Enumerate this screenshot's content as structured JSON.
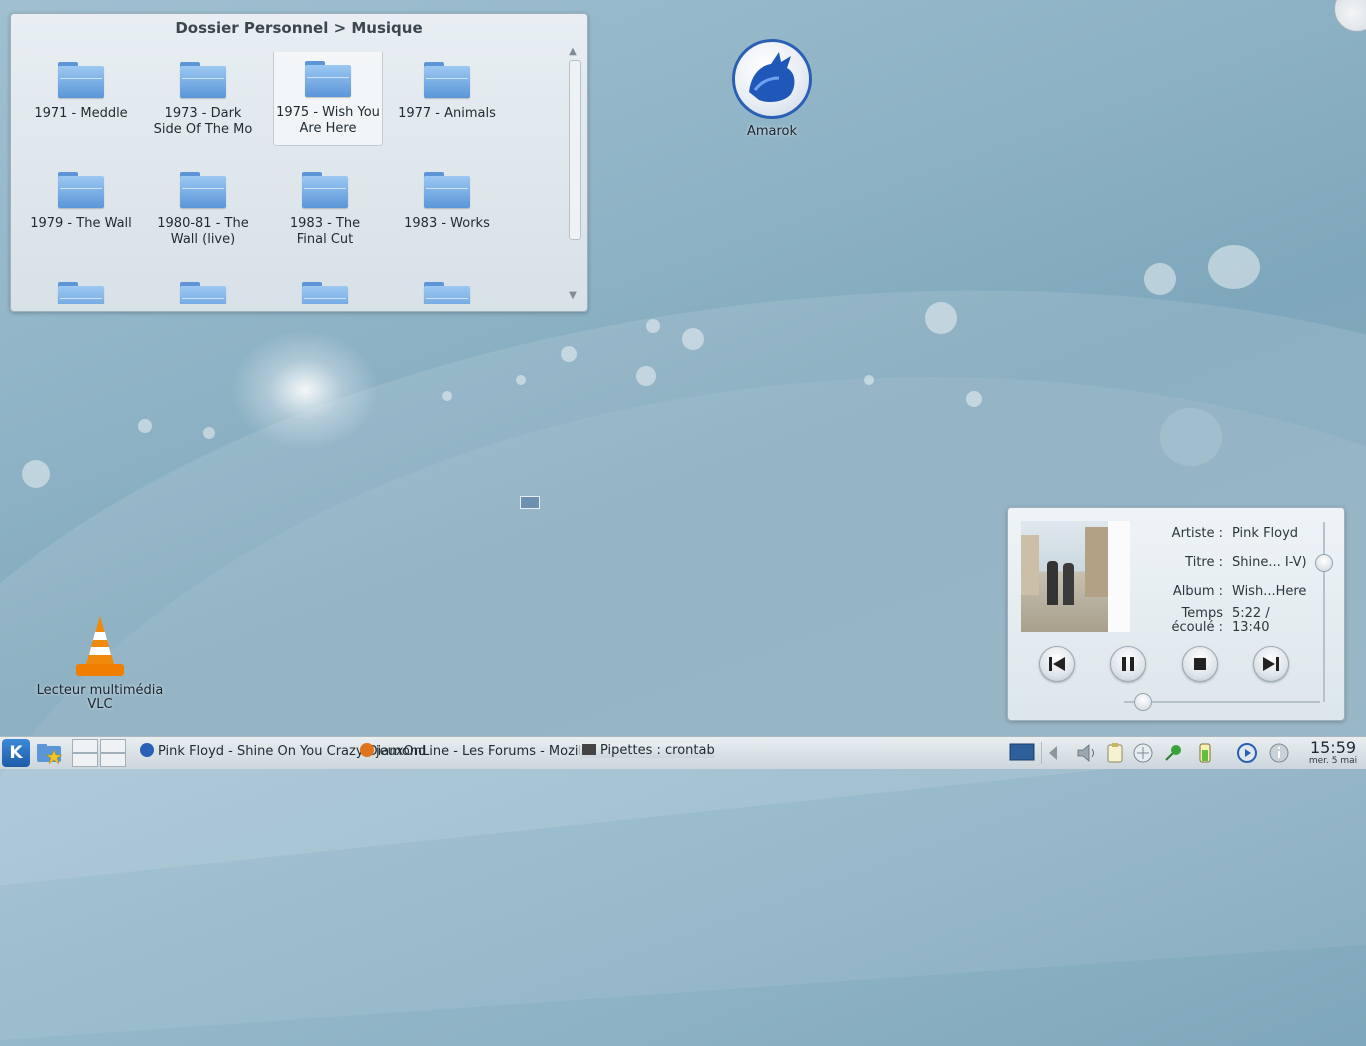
{
  "folderview": {
    "title": "Dossier Personnel > Musique",
    "items": [
      {
        "label": "1971 - Meddle"
      },
      {
        "label": "1973 - Dark Side Of The Mo"
      },
      {
        "label": "1975 - Wish You Are Here",
        "selected": true
      },
      {
        "label": "1977 - Animals"
      },
      {
        "label": "1979 - The Wall"
      },
      {
        "label": "1980-81 - The Wall (live)"
      },
      {
        "label": "1983 - The Final Cut"
      },
      {
        "label": "1983 - Works"
      }
    ]
  },
  "desktop": {
    "amarok_label": "Amarok",
    "vlc_label": "Lecteur multimédia VLC"
  },
  "player": {
    "artist_key": "Artiste :",
    "artist": "Pink Floyd",
    "title_key": "Titre :",
    "title": "Shine... I-V)",
    "album_key": "Album :",
    "album": "Wish...Here",
    "time_key_1": "Temps",
    "time_key_2": "écoulé :",
    "time_1": "5:22 /",
    "time_2": "13:40",
    "progress_fraction": 0.09
  },
  "taskbar": {
    "tasks": [
      "Pink Floyd - Shine On You Crazy Di...",
      "Forums - Mozilla...",
      "...ettes : crontab"
    ],
    "task_full": [
      "Pink Floyd - Shine On You Crazy Diamond",
      "jeuxOnLine - Les Forums - Mozilla Firefox",
      "Pipettes : crontab"
    ],
    "clock_time": "15:59",
    "clock_date": "mer. 5 mai"
  },
  "colors": {
    "accent": "#3b8ad9",
    "folder": "#5a96d8"
  }
}
